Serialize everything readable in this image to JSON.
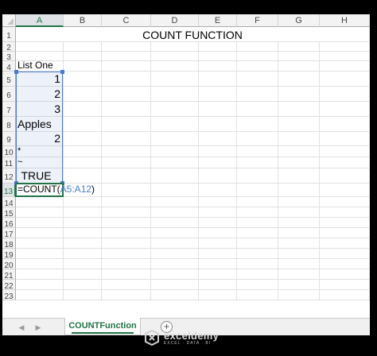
{
  "sheet": {
    "columns": [
      "A",
      "B",
      "C",
      "D",
      "E",
      "F",
      "G",
      "H"
    ],
    "rows": [
      "1",
      "2",
      "3",
      "4",
      "5",
      "6",
      "7",
      "8",
      "9",
      "10",
      "11",
      "12",
      "13",
      "14",
      "15",
      "16",
      "17",
      "18",
      "19",
      "20",
      "21",
      "22",
      "23"
    ],
    "title": "COUNT FUNCTION",
    "list_header": "List One",
    "list_values": [
      "1",
      "2",
      "3",
      "Apples",
      "2",
      "*",
      "~",
      "TRUE"
    ],
    "formula_prefix": "=COUNT(",
    "formula_range": "A5:A12",
    "formula_suffix": ")"
  },
  "tabbar": {
    "sheet_tab": "COUNTFunction",
    "add_sheet_symbol": "+",
    "prev_arrow": "◀",
    "next_arrow": "▶"
  },
  "watermark": {
    "brand": "exceldemy",
    "tagline": "EXCEL · DATA · BI"
  },
  "colors": {
    "accent": "#217346",
    "range_border": "#4b7bd0"
  }
}
